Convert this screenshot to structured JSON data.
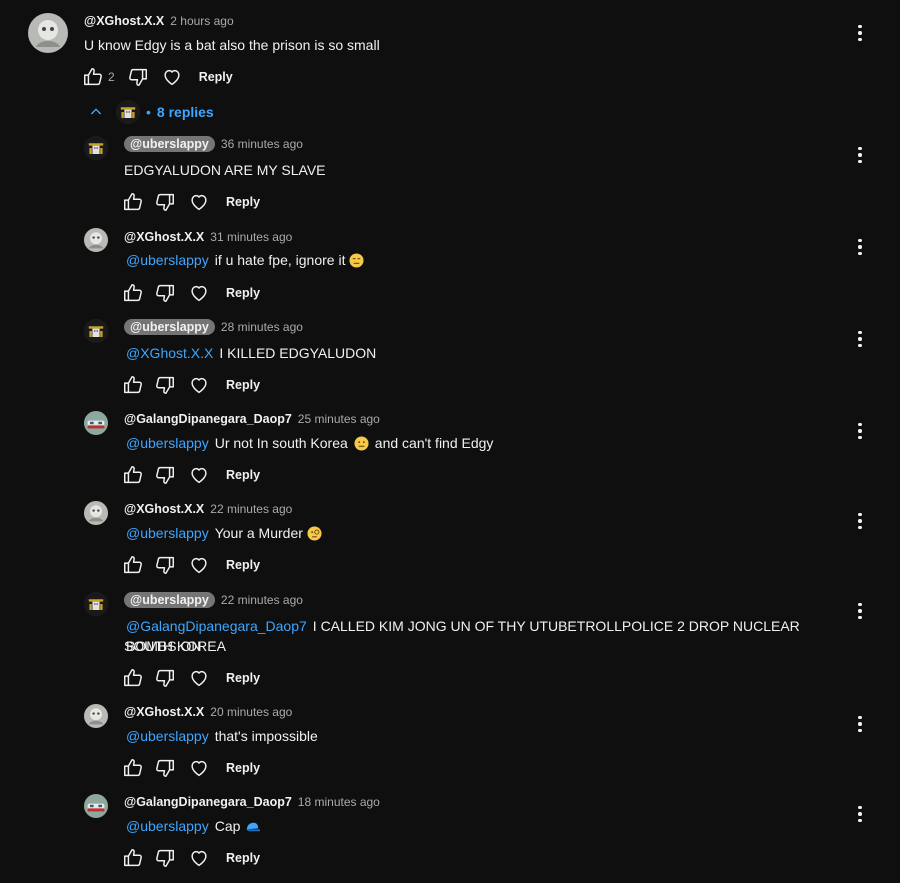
{
  "root": {
    "author": "@XGhost.X.X",
    "time": "2 hours ago",
    "text": "U know Edgy is a bat also the prison is so small",
    "likes": "2",
    "reply_label": "Reply"
  },
  "replies_toggle": {
    "label": "8 replies"
  },
  "replies": [
    {
      "author": "@uberslappy",
      "time": "36 minutes ago",
      "mention": "",
      "text": "EDGYALUDON ARE MY SLAVE",
      "reply_label": "Reply"
    },
    {
      "author": "@XGhost.X.X",
      "time": "31 minutes ago",
      "mention": "@uberslappy",
      "text": "if u hate fpe, ignore it",
      "reply_label": "Reply"
    },
    {
      "author": "@uberslappy",
      "time": "28 minutes ago",
      "mention": "@XGhost.X.X",
      "text": "I KILLED EDGYALUDON",
      "reply_label": "Reply"
    },
    {
      "author": "@GalangDipanegara_Daop7",
      "time": "25 minutes ago",
      "mention": "@uberslappy",
      "text": "Ur not In south Korea",
      "text2": "and can't find Edgy",
      "reply_label": "Reply"
    },
    {
      "author": "@XGhost.X.X",
      "time": "22 minutes ago",
      "mention": "@uberslappy",
      "text": "Your a Murder",
      "reply_label": "Reply"
    },
    {
      "author": "@uberslappy",
      "time": "22 minutes ago",
      "mention": "@GalangDipanegara_Daop7",
      "text": "I CALLED KIM JONG UN OF THY UTUBETROLLPOLICE 2 DROP NUCLEAR BOMBS ON",
      "text_line2": "SOUTH KOREA",
      "reply_label": "Reply"
    },
    {
      "author": "@XGhost.X.X",
      "time": "20 minutes ago",
      "mention": "@uberslappy",
      "text": "that's impossible",
      "reply_label": "Reply"
    },
    {
      "author": "@GalangDipanegara_Daop7",
      "time": "18 minutes ago",
      "mention": "@uberslappy",
      "text": "Cap",
      "reply_label": "Reply"
    }
  ],
  "colors": {
    "background": "#0f0f0f",
    "link": "#3ea6ff",
    "secondary": "#aaaaaa",
    "pill": "#757575"
  },
  "icons": [
    "like-icon",
    "dislike-icon",
    "heart-icon",
    "more-vert-icon",
    "chevron-up-icon"
  ]
}
